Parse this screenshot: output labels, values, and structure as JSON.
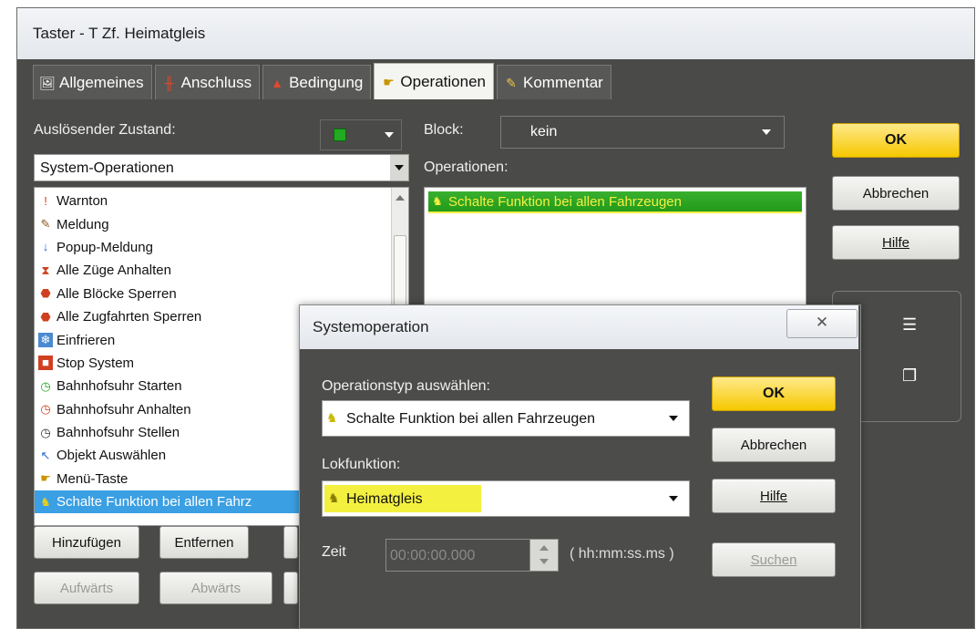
{
  "window": {
    "title": "Taster - T Zf. Heimatgleis"
  },
  "tabs": [
    {
      "label": "Allgemeines",
      "icon": "image-icon"
    },
    {
      "label": "Anschluss",
      "icon": "connector-icon"
    },
    {
      "label": "Bedingung",
      "icon": "condition-icon"
    },
    {
      "label": "Operationen",
      "icon": "hand-icon",
      "active": true
    },
    {
      "label": "Kommentar",
      "icon": "note-icon"
    }
  ],
  "left": {
    "trigger_label": "Auslösender Zustand:",
    "category_value": "System-Operationen",
    "items": [
      {
        "label": "Warnton",
        "icon": "warning-icon"
      },
      {
        "label": "Meldung",
        "icon": "pencil-icon"
      },
      {
        "label": "Popup-Meldung",
        "icon": "popup-icon"
      },
      {
        "label": "Alle Züge Anhalten",
        "icon": "stop-trains-icon"
      },
      {
        "label": "Alle Blöcke Sperren",
        "icon": "lock-blocks-icon"
      },
      {
        "label": "Alle Zugfahrten Sperren",
        "icon": "lock-routes-icon"
      },
      {
        "label": "Einfrieren",
        "icon": "freeze-icon"
      },
      {
        "label": "Stop System",
        "icon": "stop-icon"
      },
      {
        "label": "Bahnhofsuhr Starten",
        "icon": "clock-start-icon"
      },
      {
        "label": "Bahnhofsuhr Anhalten",
        "icon": "clock-stop-icon"
      },
      {
        "label": "Bahnhofsuhr Stellen",
        "icon": "clock-set-icon"
      },
      {
        "label": "Objekt Auswählen",
        "icon": "cursor-icon"
      },
      {
        "label": "Menü-Taste",
        "icon": "menu-key-icon"
      },
      {
        "label": "Schalte Funktion bei allen Fahrz",
        "icon": "function-icon",
        "selected": true
      }
    ],
    "add_label": "Hinzufügen",
    "remove_label": "Entfernen",
    "up_label": "Aufwärts",
    "down_label": "Abwärts"
  },
  "right": {
    "block_label": "Block:",
    "block_value": "kein",
    "operations_label": "Operationen:",
    "operations": [
      "Schalte Funktion bei allen Fahrzeugen"
    ]
  },
  "buttons": {
    "ok": "OK",
    "cancel": "Abbrechen",
    "help": "Hilfe"
  },
  "dialog": {
    "title": "Systemoperation",
    "close_label": "✕",
    "optype_label": "Operationstyp auswählen:",
    "optype_value": "Schalte Funktion bei allen Fahrzeugen",
    "lokfunktion_label": "Lokfunktion:",
    "lokfunktion_value": "Heimatgleis",
    "time_label": "Zeit",
    "time_value": "00:00:00.000",
    "time_format": "( hh:mm:ss.ms )",
    "ok": "OK",
    "cancel": "Abbrechen",
    "help": "Hilfe",
    "search": "Suchen"
  },
  "colors": {
    "accent_yellow": "#f6c800",
    "highlight": "#f4f040",
    "selection": "#3a9fe3",
    "green_marker": "#22aa22"
  }
}
